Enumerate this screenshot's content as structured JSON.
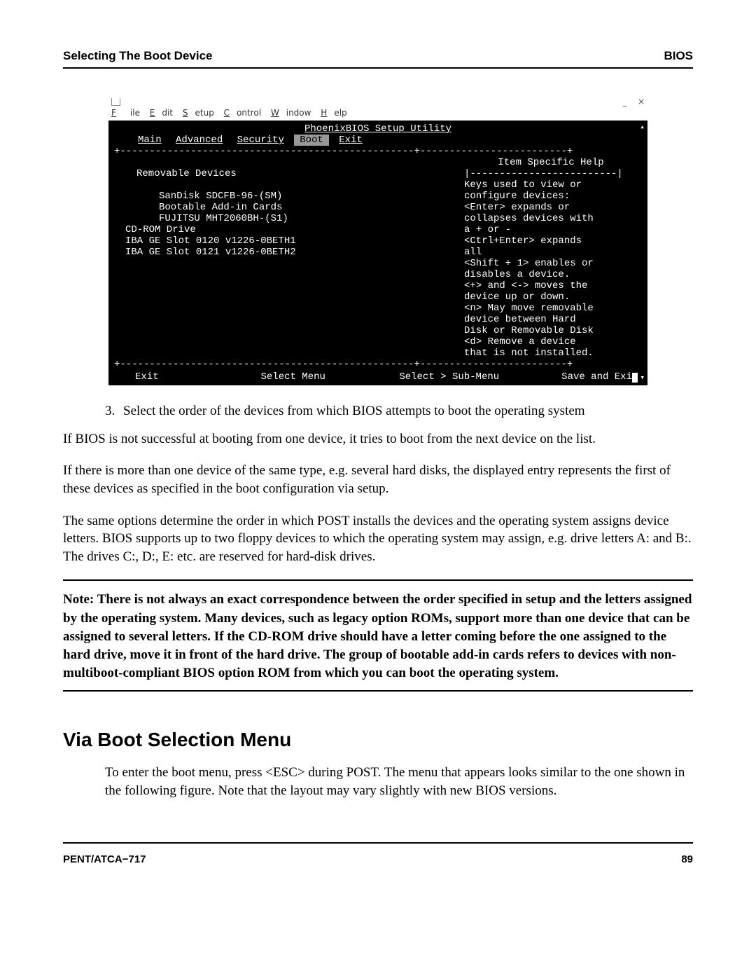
{
  "header": {
    "left": "Selecting The Boot Device",
    "right": "BIOS"
  },
  "winctrl": {
    "minimize": "_",
    "close": "×"
  },
  "menubar": {
    "file": "File",
    "edit": "Edit",
    "setup": "Setup",
    "control": "Control",
    "window": "Window",
    "help": "Help"
  },
  "bios": {
    "title": "PhoenixBIOS Setup Utility",
    "tabs": {
      "main": "Main",
      "advanced": "Advanced",
      "security": "Security",
      "boot": "Boot",
      "exit": "Exit"
    },
    "top_border": "+--------------------------------------------------+-------------------------+",
    "left": {
      "removable": "Removable Devices",
      "items": [
        "SanDisk SDCFB-96-(SM)",
        "Bootable Add-in Cards",
        "FUJITSU MHT2060BH-(S1)"
      ],
      "cdrom": "CD-ROM Drive",
      "iba1": "IBA GE Slot 0120 v1226-0BETH1",
      "iba2": "IBA GE Slot 0121 v1226-0BETH2"
    },
    "help_title": "Item Specific Help",
    "help_sep": "|-------------------------|",
    "help_lines": [
      "Keys used to view or",
      "configure devices:",
      "<Enter> expands or",
      "collapses devices with",
      "a + or -",
      "<Ctrl+Enter> expands",
      "all",
      "<Shift + 1> enables or",
      "disables a device.",
      "<+> and <-> moves the",
      "device up or down.",
      "<n> May move removable",
      "device between Hard",
      "Disk or Removable Disk",
      "<d> Remove a device",
      "that is not installed."
    ],
    "bot_border": "+--------------------------------------------------+-------------------------+",
    "bottom": {
      "exit": "Exit",
      "select_menu": "Select Menu",
      "select_sub": "Select > Sub-Menu",
      "save": "Save and Exi"
    }
  },
  "list": {
    "num3": "3.",
    "item3": "Select the order of the devices from which BIOS attempts to boot the operating system"
  },
  "paras": {
    "p1": "If BIOS is not successful at booting from one device, it tries to boot from the next device on the list.",
    "p2": "If there is more than one device of the same type, e.g. several hard disks, the displayed entry represents the first of these devices as specified in the boot configuration via setup.",
    "p3": "The same options determine the order in which POST installs the devices and the operating system assigns device letters. BIOS supports up to two floppy devices to which the operating system may assign, e.g. drive letters A: and B:. The drives C:, D:, E: etc. are reserved for hard-disk drives."
  },
  "note": {
    "lead": "Note:",
    "body": "  There is not always an exact correspondence between the order specified in setup and the letters assigned by the operating system. Many devices, such as legacy option ROMs, support more than one device that can be assigned to several letters. If the CD-ROM drive should have a letter coming before the one assigned to the hard drive, move it in front of the hard drive. The group of bootable add-in cards refers to devices with non-multiboot-compliant BIOS option ROM from which you can boot the operating system."
  },
  "h2": "Via Boot Selection Menu",
  "p4": "To enter the boot menu, press <ESC> during POST. The menu that appears looks similar to the one shown in the following figure. Note that the layout may vary slightly with new BIOS versions.",
  "footer": {
    "left": "PENT/ATCA−717",
    "right": "89"
  }
}
